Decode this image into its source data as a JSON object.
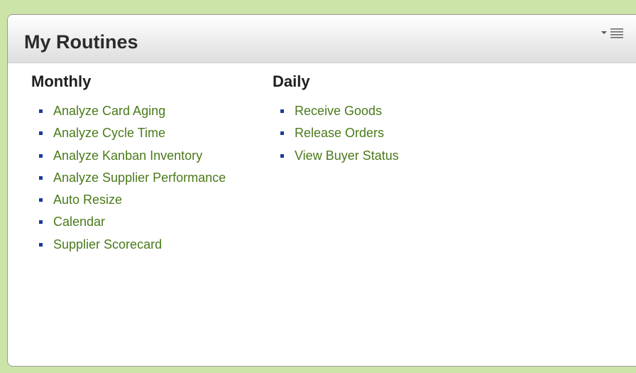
{
  "panel": {
    "title": "My Routines",
    "menu_icons": [
      "dropdown-arrow-icon",
      "hamburger-menu-icon"
    ]
  },
  "columns": {
    "monthly": {
      "heading": "Monthly",
      "items": [
        "Analyze Card Aging",
        "Analyze Cycle Time",
        "Analyze Kanban Inventory",
        "Analyze Supplier Performance",
        "Auto Resize",
        "Calendar",
        "Supplier Scorecard"
      ]
    },
    "daily": {
      "heading": "Daily",
      "items": [
        "Receive Goods",
        "Release Orders",
        "View Buyer Status"
      ]
    }
  },
  "colors": {
    "page_background": "#cce4a8",
    "link": "#4a7a1a",
    "bullet": "#1b3aa0",
    "heading": "#1f1f1f"
  }
}
